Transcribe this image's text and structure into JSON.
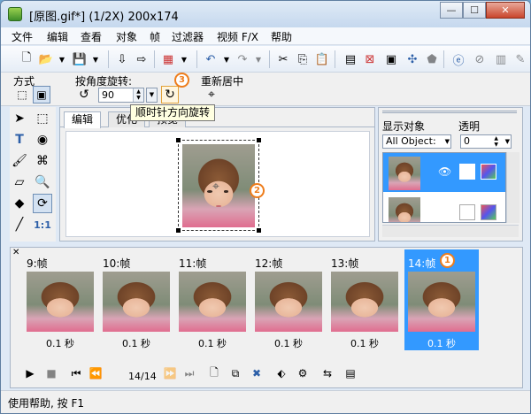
{
  "window": {
    "title": "[原图.gif*] (1/2X)  200x174",
    "buttons": {
      "minimize": "—",
      "maximize": "☐",
      "close": "✕"
    }
  },
  "menu": [
    "文件",
    "编辑",
    "查看",
    "对象",
    "帧",
    "过滤器",
    "视频 F/X",
    "帮助"
  ],
  "toolbar_icons": [
    "new-icon",
    "open-icon",
    "save-icon",
    "import-icon",
    "export-icon",
    "color-icon",
    "undo-icon",
    "redo-icon",
    "cut-icon",
    "copy-icon",
    "paste-icon",
    "image-icon",
    "delete-icon",
    "expand-icon",
    "share-icon",
    "browser-icon",
    "cancel-icon",
    "pause-icon",
    "pen-icon"
  ],
  "props": {
    "mode_label": "方式",
    "rotate_label": "按角度旋转:",
    "angle_value": "90",
    "recenter_label": "重新居中",
    "tooltip": "顺时针方向旋转"
  },
  "badges": {
    "one": "1",
    "two": "2",
    "three": "3"
  },
  "editor": {
    "tabs": [
      "编辑",
      "优化",
      "预览"
    ]
  },
  "side": {
    "display_label": "显示对象",
    "opacity_label": "透明",
    "display_value": "All Object:",
    "opacity_value": "0"
  },
  "frames": [
    {
      "label": "9:帧",
      "delay": "0.1 秒"
    },
    {
      "label": "10:帧",
      "delay": "0.1 秒"
    },
    {
      "label": "11:帧",
      "delay": "0.1 秒"
    },
    {
      "label": "12:帧",
      "delay": "0.1 秒"
    },
    {
      "label": "13:帧",
      "delay": "0.1 秒"
    },
    {
      "label": "14:帧",
      "delay": "0.1 秒"
    }
  ],
  "playback": {
    "counter": "14/14"
  },
  "status": {
    "text": "使用帮助, 按 F1"
  },
  "colors": {
    "selection": "#3399ff",
    "badge": "#ee7d1c",
    "tooltip_bg": "#ffffe1"
  }
}
